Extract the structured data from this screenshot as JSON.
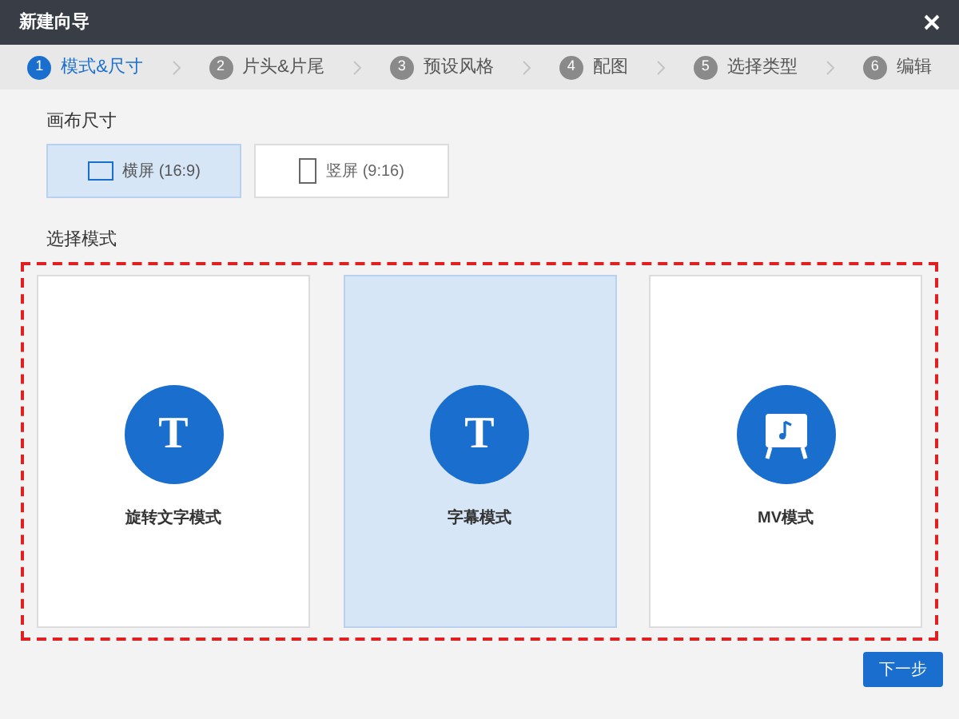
{
  "window": {
    "title": "新建向导"
  },
  "steps": [
    {
      "number": "1",
      "label": "模式&尺寸",
      "selected": true
    },
    {
      "number": "2",
      "label": "片头&片尾",
      "selected": false
    },
    {
      "number": "3",
      "label": "预设风格",
      "selected": false
    },
    {
      "number": "4",
      "label": "配图",
      "selected": false
    },
    {
      "number": "5",
      "label": "选择类型",
      "selected": false
    },
    {
      "number": "6",
      "label": "编辑",
      "selected": false
    }
  ],
  "canvas_size": {
    "heading": "画布尺寸",
    "options": [
      {
        "kind": "landscape",
        "label": "横屏 (16:9)",
        "selected": true
      },
      {
        "kind": "portrait",
        "label": "竖屏 (9:16)",
        "selected": false
      }
    ]
  },
  "mode": {
    "heading": "选择模式",
    "options": [
      {
        "kind": "letter",
        "glyph": "T",
        "label": "旋转文字模式",
        "selected": false
      },
      {
        "kind": "letter",
        "glyph": "T",
        "label": "字幕模式",
        "selected": true
      },
      {
        "kind": "mv",
        "label": "MV模式",
        "selected": false
      }
    ]
  },
  "next_button": "下一步"
}
